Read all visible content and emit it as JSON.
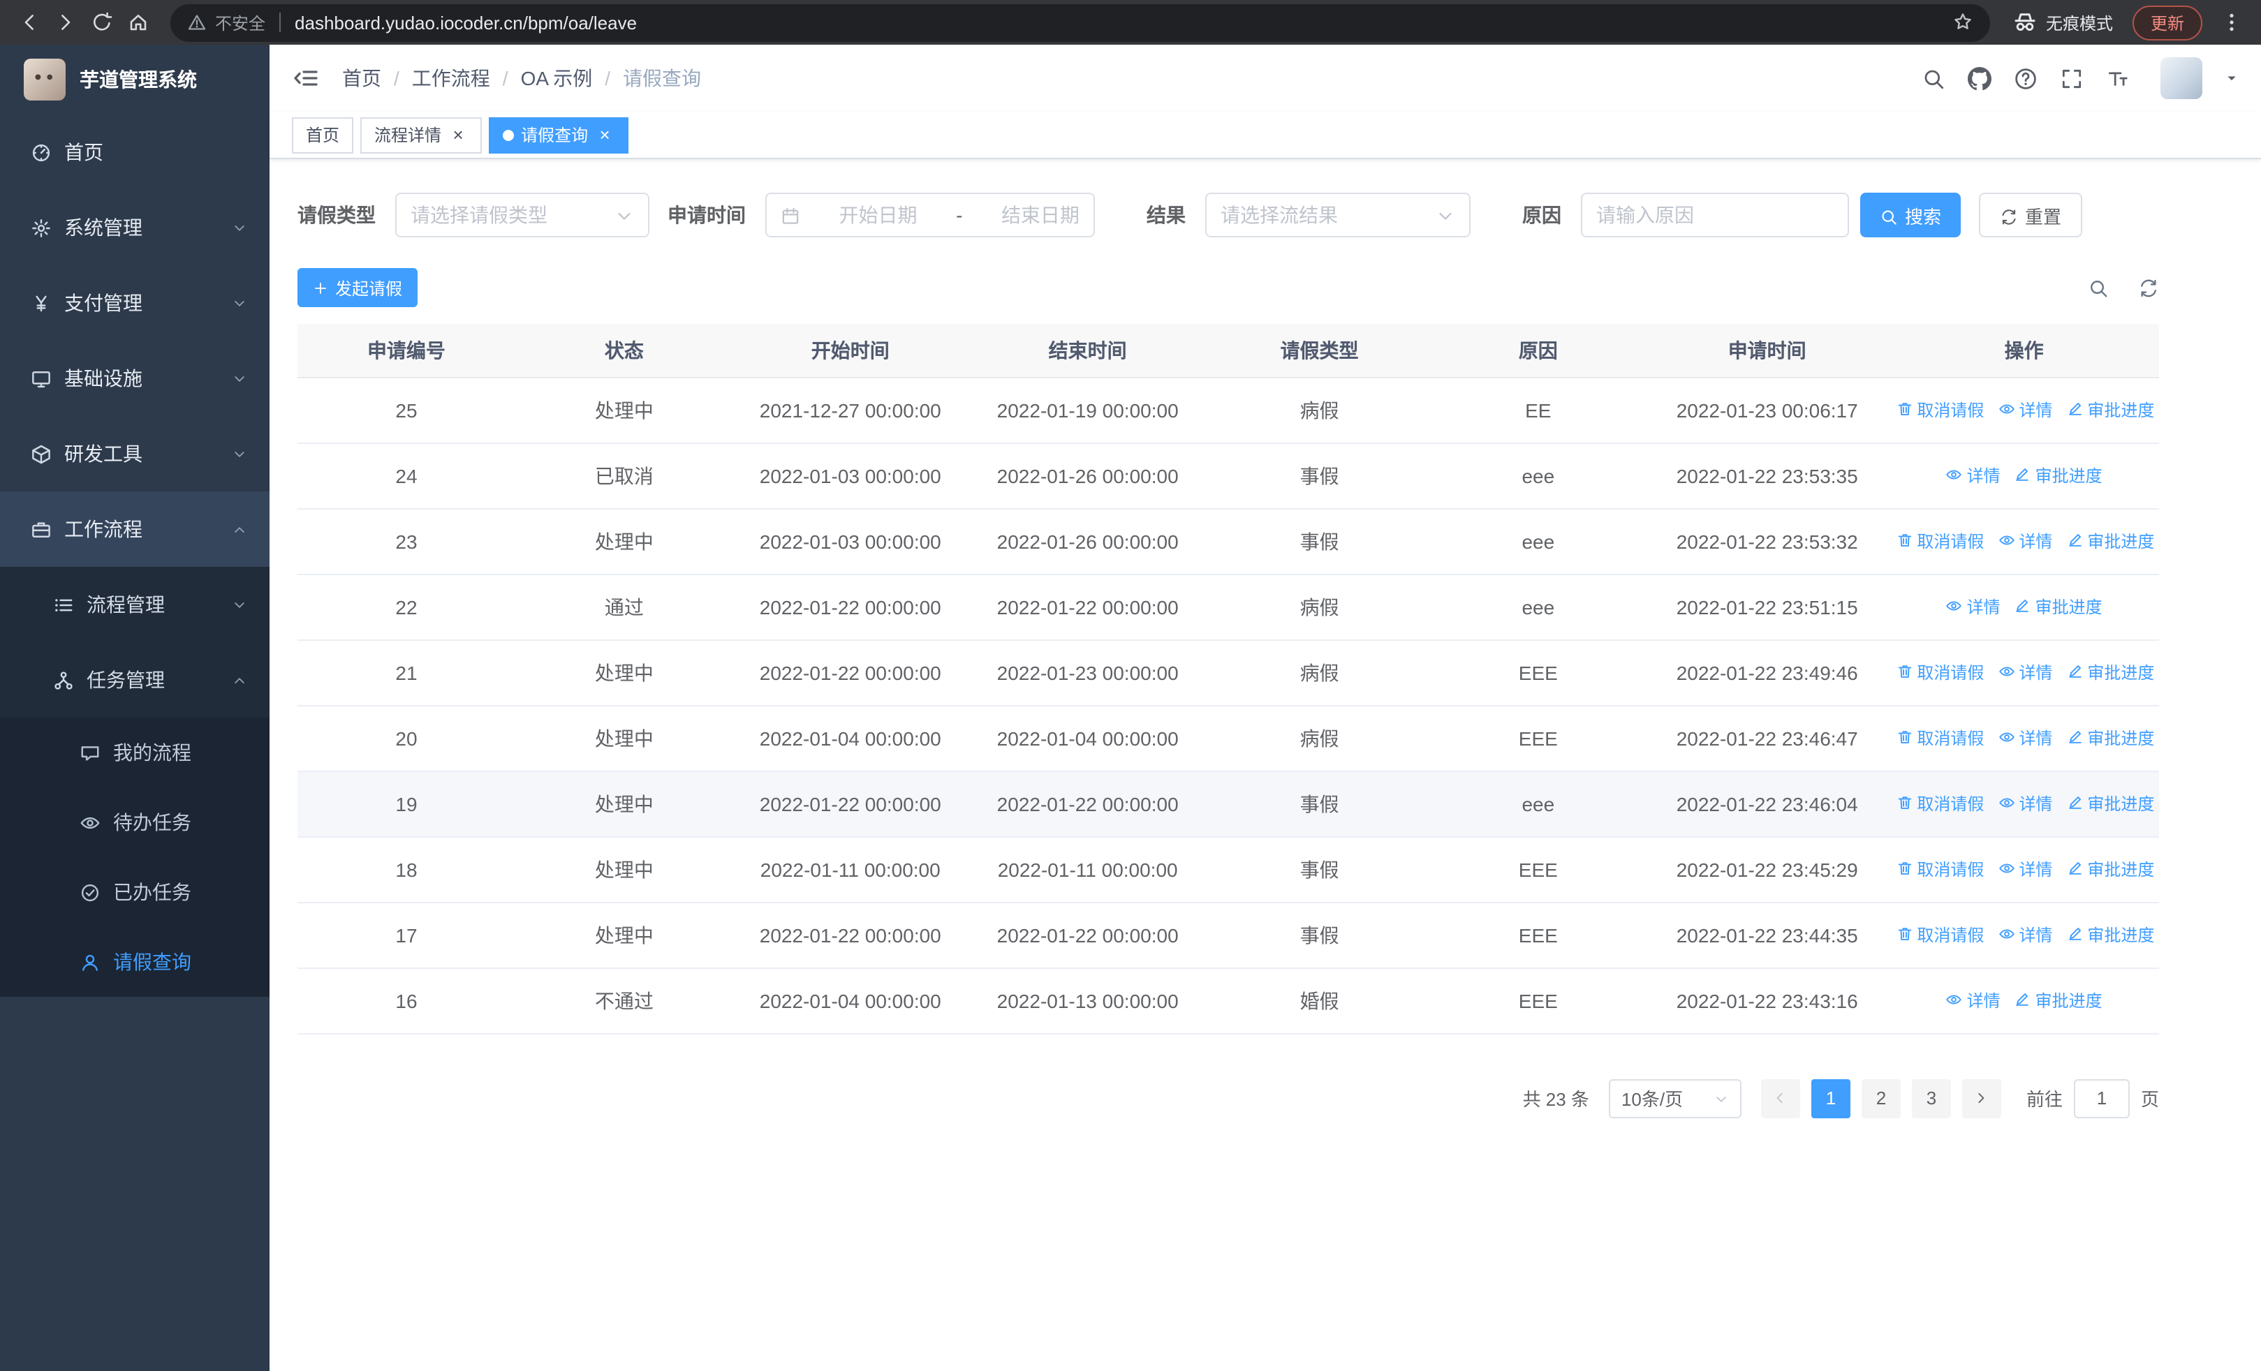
{
  "browser": {
    "security_warning": "不安全",
    "url": "dashboard.yudao.iocoder.cn/bpm/oa/leave",
    "incognito_label": "无痕模式",
    "update_label": "更新"
  },
  "sidebar": {
    "logo_title": "芋道管理系统",
    "items": [
      {
        "key": "home",
        "label": "首页",
        "icon": "dashboard-icon",
        "expandable": false,
        "expanded": false,
        "highlight": false
      },
      {
        "key": "system",
        "label": "系统管理",
        "icon": "gear-icon",
        "expandable": true,
        "expanded": false,
        "highlight": false
      },
      {
        "key": "payment",
        "label": "支付管理",
        "icon": "yen-icon",
        "expandable": true,
        "expanded": false,
        "highlight": false
      },
      {
        "key": "infrastructure",
        "label": "基础设施",
        "icon": "monitor-icon",
        "expandable": true,
        "expanded": false,
        "highlight": false
      },
      {
        "key": "devtools",
        "label": "研发工具",
        "icon": "box-icon",
        "expandable": true,
        "expanded": false,
        "highlight": false
      },
      {
        "key": "workflow",
        "label": "工作流程",
        "icon": "briefcase-icon",
        "expandable": true,
        "expanded": true,
        "highlight": true
      }
    ],
    "submenu": [
      {
        "key": "process-management",
        "label": "流程管理",
        "icon": "list-icon",
        "expandable": true,
        "expanded": false
      },
      {
        "key": "task-management",
        "label": "任务管理",
        "icon": "org-icon",
        "expandable": true,
        "expanded": true
      }
    ],
    "leaf_items": [
      {
        "key": "my-process",
        "label": "我的流程",
        "icon": "chat-icon",
        "active": false
      },
      {
        "key": "todo-tasks",
        "label": "待办任务",
        "icon": "eye-icon",
        "active": false
      },
      {
        "key": "done-tasks",
        "label": "已办任务",
        "icon": "check-circle-icon",
        "active": false
      },
      {
        "key": "leave-query",
        "label": "请假查询",
        "icon": "user-icon",
        "active": true
      }
    ]
  },
  "header": {
    "breadcrumbs": [
      "首页",
      "工作流程",
      "OA 示例",
      "请假查询"
    ],
    "separator": "/"
  },
  "tabs": [
    {
      "key": "home",
      "label": "首页",
      "closable": false,
      "active": false
    },
    {
      "key": "process-detail",
      "label": "流程详情",
      "closable": true,
      "active": false
    },
    {
      "key": "leave-query",
      "label": "请假查询",
      "closable": true,
      "active": true
    }
  ],
  "filters": {
    "leave_type_label": "请假类型",
    "leave_type_placeholder": "请选择请假类型",
    "apply_time_label": "申请时间",
    "start_date_placeholder": "开始日期",
    "range_separator": "-",
    "end_date_placeholder": "结束日期",
    "result_label": "结果",
    "result_placeholder": "请选择流结果",
    "reason_label": "原因",
    "reason_placeholder": "请输入原因",
    "search_button": "搜索",
    "reset_button": "重置"
  },
  "toolbar": {
    "create_button": "发起请假"
  },
  "table": {
    "columns": [
      "申请编号",
      "状态",
      "开始时间",
      "结束时间",
      "请假类型",
      "原因",
      "申请时间",
      "操作"
    ],
    "action_labels": {
      "cancel": "取消请假",
      "detail": "详情",
      "progress": "审批进度"
    },
    "rows": [
      {
        "id": "25",
        "status": "处理中",
        "start": "2021-12-27 00:00:00",
        "end": "2022-01-19 00:00:00",
        "type": "病假",
        "reason": "EE",
        "apply_time": "2022-01-23 00:06:17",
        "cancelable": true,
        "hover": false
      },
      {
        "id": "24",
        "status": "已取消",
        "start": "2022-01-03 00:00:00",
        "end": "2022-01-26 00:00:00",
        "type": "事假",
        "reason": "eee",
        "apply_time": "2022-01-22 23:53:35",
        "cancelable": false,
        "hover": false
      },
      {
        "id": "23",
        "status": "处理中",
        "start": "2022-01-03 00:00:00",
        "end": "2022-01-26 00:00:00",
        "type": "事假",
        "reason": "eee",
        "apply_time": "2022-01-22 23:53:32",
        "cancelable": true,
        "hover": false
      },
      {
        "id": "22",
        "status": "通过",
        "start": "2022-01-22 00:00:00",
        "end": "2022-01-22 00:00:00",
        "type": "病假",
        "reason": "eee",
        "apply_time": "2022-01-22 23:51:15",
        "cancelable": false,
        "hover": false
      },
      {
        "id": "21",
        "status": "处理中",
        "start": "2022-01-22 00:00:00",
        "end": "2022-01-23 00:00:00",
        "type": "病假",
        "reason": "EEE",
        "apply_time": "2022-01-22 23:49:46",
        "cancelable": true,
        "hover": false
      },
      {
        "id": "20",
        "status": "处理中",
        "start": "2022-01-04 00:00:00",
        "end": "2022-01-04 00:00:00",
        "type": "病假",
        "reason": "EEE",
        "apply_time": "2022-01-22 23:46:47",
        "cancelable": true,
        "hover": false
      },
      {
        "id": "19",
        "status": "处理中",
        "start": "2022-01-22 00:00:00",
        "end": "2022-01-22 00:00:00",
        "type": "事假",
        "reason": "eee",
        "apply_time": "2022-01-22 23:46:04",
        "cancelable": true,
        "hover": true
      },
      {
        "id": "18",
        "status": "处理中",
        "start": "2022-01-11 00:00:00",
        "end": "2022-01-11 00:00:00",
        "type": "事假",
        "reason": "EEE",
        "apply_time": "2022-01-22 23:45:29",
        "cancelable": true,
        "hover": false
      },
      {
        "id": "17",
        "status": "处理中",
        "start": "2022-01-22 00:00:00",
        "end": "2022-01-22 00:00:00",
        "type": "事假",
        "reason": "EEE",
        "apply_time": "2022-01-22 23:44:35",
        "cancelable": true,
        "hover": false
      },
      {
        "id": "16",
        "status": "不通过",
        "start": "2022-01-04 00:00:00",
        "end": "2022-01-13 00:00:00",
        "type": "婚假",
        "reason": "EEE",
        "apply_time": "2022-01-22 23:43:16",
        "cancelable": false,
        "hover": false
      }
    ]
  },
  "pagination": {
    "total_text": "共 23 条",
    "page_size": "10条/页",
    "pages": [
      "1",
      "2",
      "3"
    ],
    "active_page": "1",
    "goto_label": "前往",
    "goto_value": "1",
    "goto_suffix": "页"
  },
  "colors": {
    "accent": "#409eff",
    "sidebar_bg": "#2d3a4b",
    "submenu_bg": "#212c3b",
    "leaf_bg": "#1b2533",
    "link": "#409eff"
  }
}
